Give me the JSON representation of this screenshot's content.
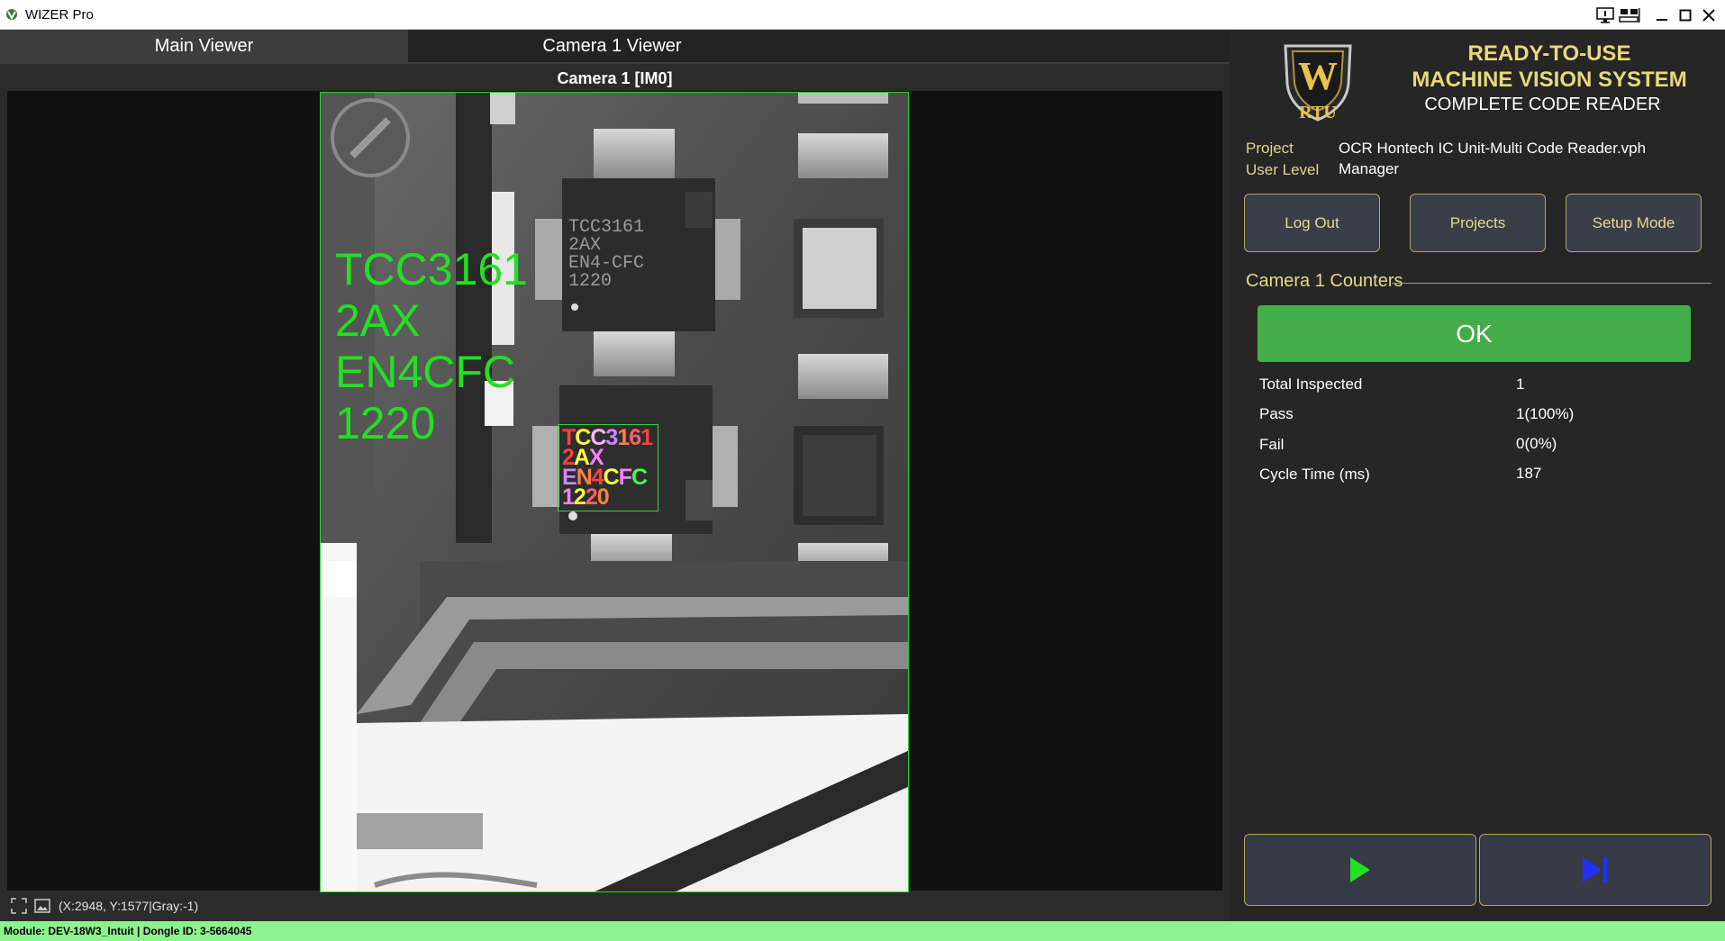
{
  "window": {
    "title": "WIZER Pro"
  },
  "tabs": [
    {
      "label": "Main Viewer",
      "active": true
    },
    {
      "label": "Camera 1 Viewer",
      "active": false
    }
  ],
  "viewer": {
    "camera_title": "Camera 1  [IM0]",
    "ocr_result_lines": [
      "TCC3161",
      "2AX",
      "EN4CFC",
      "1220"
    ],
    "ocr_overlay_chars": [
      [
        {
          "c": "T",
          "color": "#ff4040"
        },
        {
          "c": "C",
          "color": "#ffff40"
        },
        {
          "c": "C",
          "color": "#ffb6ff"
        },
        {
          "c": "3",
          "color": "#cc88ff"
        },
        {
          "c": "1",
          "color": "#ff8040"
        },
        {
          "c": "6",
          "color": "#ff6060"
        },
        {
          "c": "1",
          "color": "#ff4040"
        }
      ],
      [
        {
          "c": "2",
          "color": "#ff4040"
        },
        {
          "c": "A",
          "color": "#ffff40"
        },
        {
          "c": "X",
          "color": "#ff80ff"
        }
      ],
      [
        {
          "c": "E",
          "color": "#cc88ff"
        },
        {
          "c": "N",
          "color": "#ff8040"
        },
        {
          "c": "4",
          "color": "#ff4040"
        },
        {
          "c": "C",
          "color": "#ffff40"
        },
        {
          "c": "F",
          "color": "#ff80ff"
        },
        {
          "c": "C",
          "color": "#40ff40"
        }
      ],
      [
        {
          "c": "1",
          "color": "#ff80ff"
        },
        {
          "c": "2",
          "color": "#ffff40"
        },
        {
          "c": "2",
          "color": "#ff6060"
        },
        {
          "c": "0",
          "color": "#ff8040"
        }
      ]
    ],
    "chip_print_lines": [
      "TCC3161",
      "2AX",
      "EN4-CFC",
      "1220"
    ],
    "coords": "(X:2948, Y:1577|Gray:-1)"
  },
  "brand": {
    "line1": "READY-TO-USE",
    "line2": "MACHINE VISION SYSTEM",
    "line3": "COMPLETE CODE READER",
    "logo_letter": "W",
    "logo_text": "RTU"
  },
  "info": {
    "project_label": "Project",
    "project_value": "OCR Hontech IC Unit-Multi Code Reader.vph",
    "level_label": "User Level",
    "level_value": "Manager"
  },
  "buttons": {
    "logout": "Log Out",
    "projects": "Projects",
    "setup": "Setup Mode"
  },
  "counters": {
    "title": "Camera 1 Counters",
    "status": "OK",
    "rows": [
      {
        "label": "Total Inspected",
        "value": "1"
      },
      {
        "label": "Pass",
        "value": "1(100%)"
      },
      {
        "label": "Fail",
        "value": "0(0%)"
      },
      {
        "label": "Cycle Time (ms)",
        "value": "187"
      }
    ]
  },
  "colors": {
    "ok_green": "#45ad48",
    "overlay_green": "#22e022",
    "button_border": "#b8a460",
    "status_bar": "#8ef28e"
  },
  "statusbar": {
    "text": "Module: DEV-18W3_Intuit | Dongle ID: 3-5664045"
  }
}
